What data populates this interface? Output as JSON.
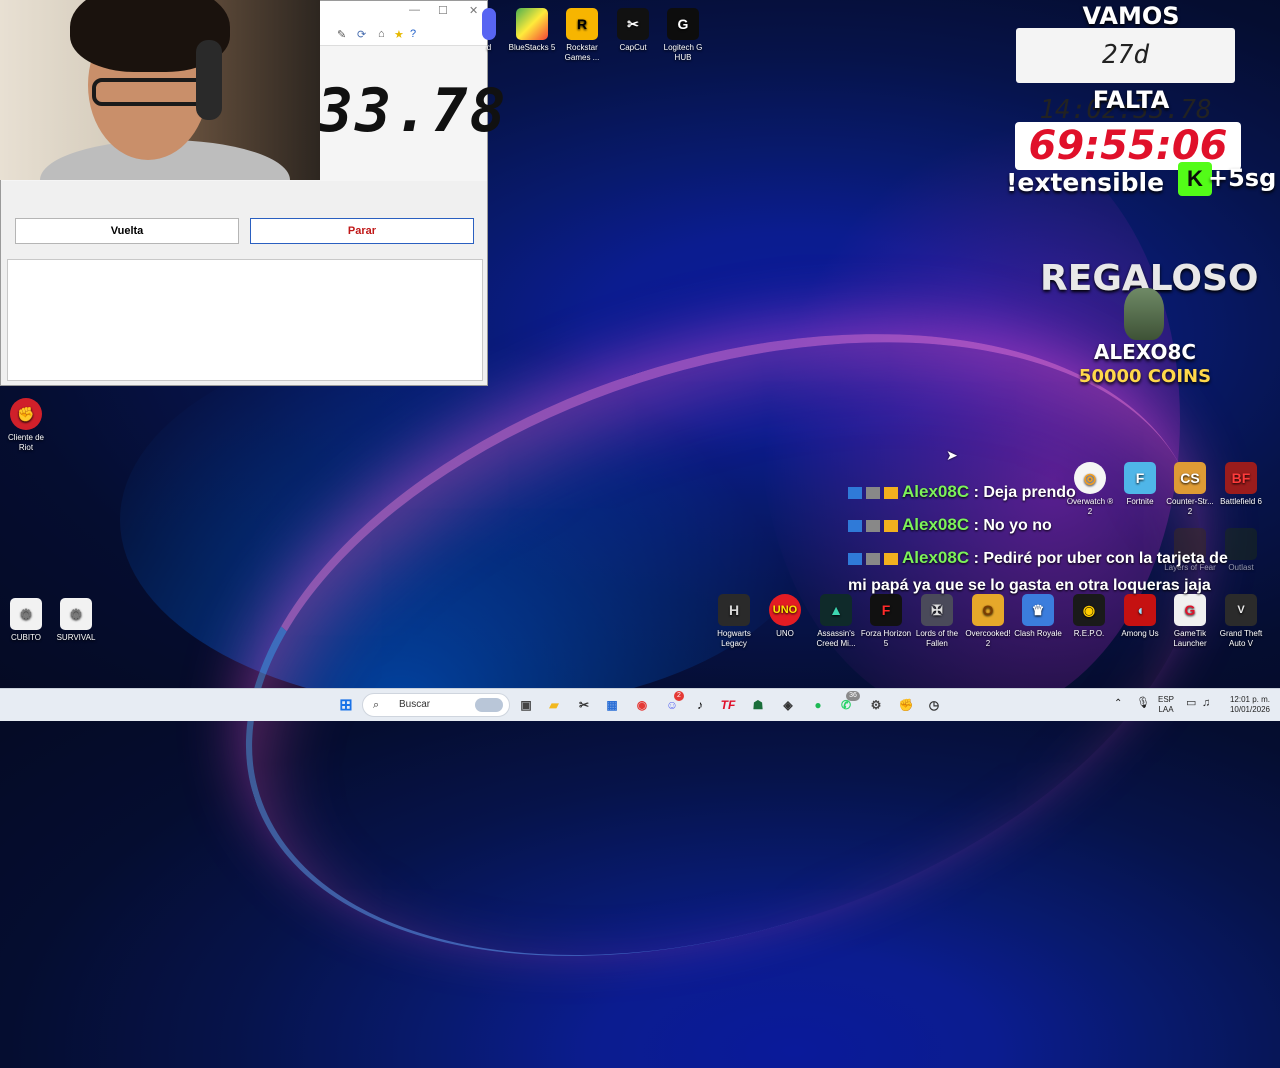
{
  "stopwatch": {
    "time_display": "33.78",
    "lap_button": "Vuelta",
    "stop_button": "Parar"
  },
  "desktop_icons_top": [
    {
      "label": "d",
      "icon": "app-icon"
    },
    {
      "label": "BlueStacks 5",
      "icon": "bluestacks-icon"
    },
    {
      "label": "Rockstar Games ...",
      "icon": "rockstar-icon"
    },
    {
      "label": "CapCut",
      "icon": "capcut-icon"
    },
    {
      "label": "Logitech G HUB",
      "icon": "logitech-icon"
    }
  ],
  "desktop_icons_left": [
    {
      "label": "Cliente de Riot",
      "icon": "riot-icon"
    },
    {
      "label": "CUBITO",
      "icon": "shortcut-icon"
    },
    {
      "label": "SURVIVAL",
      "icon": "shortcut-icon"
    }
  ],
  "desktop_icons_right": [
    {
      "label": "Overwatch ® 2",
      "icon": "overwatch-icon"
    },
    {
      "label": "Fortnite",
      "icon": "fortnite-icon"
    },
    {
      "label": "Counter-Str... 2",
      "icon": "cs2-icon"
    },
    {
      "label": "Battlefield 6",
      "icon": "battlefield-icon"
    },
    {
      "label": "Layers of Fear",
      "icon": "layers-icon"
    },
    {
      "label": "Outlast",
      "icon": "outlast-icon"
    }
  ],
  "desktop_icons_bottom": [
    {
      "label": "Hogwarts Legacy",
      "icon": "hogwarts-icon"
    },
    {
      "label": "UNO",
      "icon": "uno-icon"
    },
    {
      "label": "Assassin's Creed Mi...",
      "icon": "assassins-icon"
    },
    {
      "label": "Forza Horizon 5",
      "icon": "forza-icon"
    },
    {
      "label": "Lords of the Fallen",
      "icon": "lords-icon"
    },
    {
      "label": "Overcooked! 2",
      "icon": "overcooked-icon"
    },
    {
      "label": "Clash Royale",
      "icon": "clash-icon"
    },
    {
      "label": "R.E.P.O.",
      "icon": "repo-icon"
    },
    {
      "label": "Among Us",
      "icon": "amongus-icon"
    },
    {
      "label": "GameTik Launcher",
      "icon": "gametik-icon"
    },
    {
      "label": "Grand Theft Auto V",
      "icon": "gta-icon"
    }
  ],
  "overlay": {
    "vamos": "VAMOS",
    "elapsed": "27d 14:02:33.78",
    "falta": "FALTA",
    "remaining": "69:55:06",
    "extensible": "!extensible",
    "kick_bonus": "+5sg",
    "regaloso": "REGALOSO",
    "gifter": "ALEXO8C",
    "coins": "50000 COINS"
  },
  "chat": [
    {
      "user": "Alex08C",
      "message": ": Deja prendo"
    },
    {
      "user": "Alex08C",
      "message": ": No yo no"
    },
    {
      "user": "Alex08C",
      "message": ": Pediré por uber con la tarjeta de"
    },
    {
      "user": "",
      "message": "mi papá ya que se lo gasta en otra loqueras jaja"
    }
  ],
  "taskbar": {
    "search_placeholder": "Buscar",
    "lang_top": "ESP",
    "lang_bottom": "LAA",
    "time": "12:01 p. m.",
    "date": "10/01/2026",
    "discord_badge": "2",
    "whatsapp_badge": "36"
  },
  "colors": {
    "accent_red": "#e0102a",
    "chat_name": "#7cf25a",
    "kick_green": "#53fc18"
  }
}
